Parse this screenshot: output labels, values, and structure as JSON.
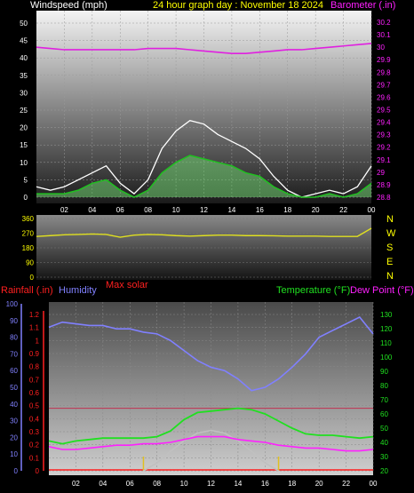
{
  "chart_data": [
    {
      "type": "line",
      "title": "24 hour graph day : November 18 2024",
      "left_axis": {
        "label": "Windspeed (mph)",
        "ticks": [
          "0",
          "5",
          "10",
          "15",
          "20",
          "25",
          "30",
          "35",
          "40",
          "45",
          "50"
        ],
        "range": [
          0,
          50
        ]
      },
      "right_axis": {
        "label": "Barometer (.in)",
        "ticks": [
          "28.8",
          "28.9",
          "29",
          "29.1",
          "29.2",
          "29.3",
          "29.4",
          "29.5",
          "29.6",
          "29.7",
          "29.8",
          "29.9",
          "30",
          "30.1",
          "30.2"
        ],
        "range": [
          28.8,
          30.25
        ]
      },
      "x_ticks": [
        "02",
        "04",
        "06",
        "08",
        "10",
        "12",
        "14",
        "16",
        "18",
        "20",
        "22",
        "00"
      ],
      "series": [
        {
          "name": "Barometer",
          "color": "#e020e0",
          "x": [
            0,
            1,
            2,
            3,
            4,
            5,
            6,
            7,
            8,
            9,
            10,
            11,
            12,
            13,
            14,
            15,
            16,
            17,
            18,
            19,
            20,
            21,
            22,
            23,
            24
          ],
          "values": [
            30.0,
            29.99,
            29.98,
            29.98,
            29.98,
            29.98,
            29.98,
            29.98,
            29.99,
            29.99,
            29.99,
            29.98,
            29.97,
            29.96,
            29.95,
            29.95,
            29.96,
            29.97,
            29.98,
            29.98,
            29.99,
            30.0,
            30.01,
            30.02,
            30.03
          ]
        },
        {
          "name": "Wind gust",
          "color": "#ffffff",
          "x": [
            0,
            1,
            2,
            3,
            4,
            5,
            6,
            7,
            8,
            9,
            10,
            11,
            12,
            13,
            14,
            15,
            16,
            17,
            18,
            19,
            20,
            21,
            22,
            23,
            24
          ],
          "values": [
            3,
            2,
            3,
            5,
            7,
            9,
            4,
            1,
            5,
            14,
            19,
            22,
            21,
            18,
            16,
            14,
            11,
            6,
            2,
            0,
            1,
            2,
            1,
            3,
            9
          ]
        },
        {
          "name": "Wind speed",
          "color": "#20c020",
          "x": [
            0,
            1,
            2,
            3,
            4,
            5,
            6,
            7,
            8,
            9,
            10,
            11,
            12,
            13,
            14,
            15,
            16,
            17,
            18,
            19,
            20,
            21,
            22,
            23,
            24
          ],
          "values": [
            1,
            1,
            1,
            2,
            4,
            5,
            2,
            0,
            2,
            7,
            10,
            12,
            11,
            10,
            9,
            7,
            6,
            3,
            1,
            0,
            0,
            1,
            0,
            1,
            4
          ]
        }
      ]
    },
    {
      "type": "line",
      "title": "",
      "left_axis": {
        "ticks": [
          "0",
          "90",
          "180",
          "270",
          "360"
        ],
        "range": [
          0,
          360
        ]
      },
      "right_labels": [
        "N",
        "W",
        "S",
        "E",
        "N"
      ],
      "series": [
        {
          "name": "Wind direction",
          "color": "#e0e020",
          "x": [
            0,
            1,
            2,
            3,
            4,
            5,
            6,
            7,
            8,
            9,
            10,
            11,
            12,
            13,
            14,
            15,
            16,
            17,
            18,
            19,
            20,
            21,
            22,
            23,
            24
          ],
          "values": [
            250,
            255,
            260,
            262,
            265,
            262,
            245,
            258,
            262,
            260,
            255,
            252,
            255,
            258,
            258,
            255,
            255,
            254,
            252,
            252,
            252,
            250,
            250,
            250,
            300
          ]
        }
      ]
    },
    {
      "type": "line",
      "title": "",
      "left_labels": {
        "rainfall": "Rainfall (.in)",
        "humidity": "Humidity",
        "max_solar": "Max solar"
      },
      "right_labels": {
        "temperature": "Temperature (°F)",
        "dew_point": "Dew Point (°F)"
      },
      "humidity_ticks": [
        "0",
        "10",
        "20",
        "30",
        "40",
        "50",
        "60",
        "70",
        "80",
        "90",
        "100"
      ],
      "rain_ticks": [
        "0",
        "0.1",
        "0.2",
        "0.3",
        "0.4",
        "0.5",
        "0.6",
        "0.7",
        "0.8",
        "0.9",
        "1",
        "1.1",
        "1.2"
      ],
      "temp_ticks": [
        "20",
        "30",
        "40",
        "50",
        "60",
        "70",
        "80",
        "90",
        "100",
        "110",
        "120",
        "130"
      ],
      "x_ticks": [
        "02",
        "04",
        "06",
        "08",
        "10",
        "12",
        "14",
        "16",
        "18",
        "20",
        "22",
        "00"
      ],
      "series": [
        {
          "name": "Humidity",
          "color": "#8080ff",
          "x": [
            0,
            1,
            2,
            3,
            4,
            5,
            6,
            7,
            8,
            9,
            10,
            11,
            12,
            13,
            14,
            15,
            16,
            17,
            18,
            19,
            20,
            21,
            22,
            23,
            24
          ],
          "values": [
            86,
            89,
            88,
            87,
            87,
            85,
            85,
            83,
            82,
            78,
            72,
            66,
            62,
            60,
            55,
            48,
            50,
            55,
            62,
            70,
            80,
            84,
            88,
            92,
            82
          ]
        },
        {
          "name": "Temperature",
          "color": "#20e020",
          "x": [
            0,
            1,
            2,
            3,
            4,
            5,
            6,
            7,
            8,
            9,
            10,
            11,
            12,
            13,
            14,
            15,
            16,
            17,
            18,
            19,
            20,
            21,
            22,
            23,
            24
          ],
          "values": [
            41,
            39,
            41,
            42,
            43,
            43,
            43,
            43,
            44,
            48,
            56,
            61,
            62,
            63,
            64,
            63,
            60,
            55,
            50,
            46,
            45,
            45,
            44,
            43,
            44
          ]
        },
        {
          "name": "Dew Point",
          "color": "#ff20ff",
          "x": [
            0,
            1,
            2,
            3,
            4,
            5,
            6,
            7,
            8,
            9,
            10,
            11,
            12,
            13,
            14,
            15,
            16,
            17,
            18,
            19,
            20,
            21,
            22,
            23,
            24
          ],
          "values": [
            37,
            35,
            35,
            36,
            37,
            38,
            38,
            39,
            39,
            40,
            42,
            44,
            44,
            44,
            42,
            41,
            40,
            38,
            37,
            36,
            36,
            35,
            34,
            34,
            35
          ]
        },
        {
          "name": "Max solar",
          "color": "#c0c0c0",
          "x": [
            7,
            8,
            9,
            10,
            11,
            12,
            13,
            14,
            15,
            16,
            17
          ],
          "values": [
            0,
            0.06,
            0.15,
            0.23,
            0.29,
            0.31,
            0.29,
            0.23,
            0.15,
            0.06,
            0
          ]
        }
      ]
    }
  ]
}
